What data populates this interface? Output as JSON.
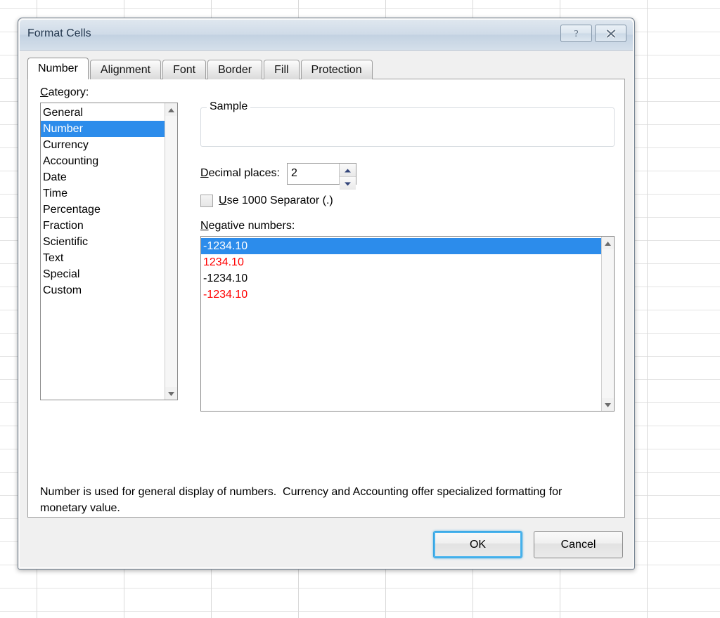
{
  "window": {
    "title": "Format Cells",
    "help_button": "help-icon",
    "close_button": "close-icon"
  },
  "tabs": [
    {
      "label": "Number",
      "active": true
    },
    {
      "label": "Alignment",
      "active": false
    },
    {
      "label": "Font",
      "active": false
    },
    {
      "label": "Border",
      "active": false
    },
    {
      "label": "Fill",
      "active": false
    },
    {
      "label": "Protection",
      "active": false
    }
  ],
  "category": {
    "label": "Category:",
    "items": [
      "General",
      "Number",
      "Currency",
      "Accounting",
      "Date",
      "Time",
      "Percentage",
      "Fraction",
      "Scientific",
      "Text",
      "Special",
      "Custom"
    ],
    "selected": "Number"
  },
  "sample": {
    "legend": "Sample",
    "value": ""
  },
  "decimal_places": {
    "label": "Decimal places:",
    "label_prefix": "D",
    "label_rest": "ecimal places:",
    "value": "2",
    "up_icon": "spinner-up-icon",
    "down_icon": "spinner-down-icon"
  },
  "thousands_separator": {
    "label": "Use 1000 Separator (.)",
    "label_prefix": "U",
    "label_rest": "se 1000 Separator (.)",
    "checked": false
  },
  "negative_numbers": {
    "label": "Negative numbers:",
    "label_prefix": "N",
    "label_rest": "egative numbers:",
    "items": [
      {
        "text": "-1234.10",
        "color": "#ffffff",
        "selected": true
      },
      {
        "text": "1234.10",
        "color": "#ff0000",
        "selected": false
      },
      {
        "text": "-1234.10",
        "color": "#000000",
        "selected": false
      },
      {
        "text": "-1234.10",
        "color": "#ff0000",
        "selected": false
      }
    ]
  },
  "description": "Number is used for general display of numbers.  Currency and Accounting offer specialized formatting for monetary value.",
  "footer": {
    "ok_label": "OK",
    "cancel_label": "Cancel"
  },
  "colors": {
    "selection_blue": "#2c8ceb",
    "negative_red": "#ff0000",
    "default_button_focus": "#49b4ee",
    "titlebar": "#cfdbe8"
  },
  "scrollbars": {
    "up_icon": "scroll-up-arrow-icon",
    "down_icon": "scroll-down-arrow-icon"
  }
}
